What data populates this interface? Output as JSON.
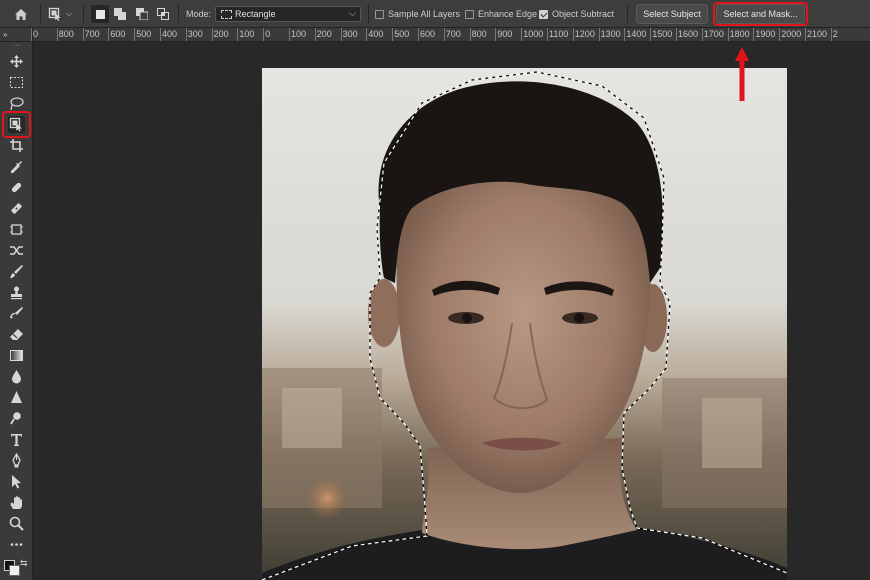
{
  "options_bar": {
    "mode_label": "Mode:",
    "mode_value": "Rectangle",
    "sample_all_layers": {
      "label": "Sample All Layers",
      "checked": false
    },
    "enhance_edge": {
      "label": "Enhance Edge",
      "checked": false
    },
    "object_subtract": {
      "label": "Object Subtract",
      "checked": true
    },
    "select_subject_label": "Select Subject",
    "select_and_mask_label": "Select and Mask..."
  },
  "ruler": {
    "corner": "»",
    "labels": [
      "0",
      "800",
      "700",
      "600",
      "500",
      "400",
      "300",
      "200",
      "100",
      "0",
      "100",
      "200",
      "300",
      "400",
      "500",
      "600",
      "700",
      "800",
      "900",
      "1000",
      "1100",
      "1200",
      "1300",
      "1400",
      "1500",
      "1600",
      "1700",
      "1800",
      "1900",
      "2000",
      "2100",
      "2"
    ]
  },
  "toolbar": {
    "tools": [
      "move-tool",
      "rectangular-marquee-tool",
      "lasso-tool",
      "object-selection-tool",
      "crop-tool",
      "eyedropper-tool",
      "spot-healing-brush-tool",
      "patch-tool",
      "frame-tool",
      "content-aware-move-tool",
      "brush-tool",
      "clone-stamp-tool",
      "history-brush-tool",
      "eraser-tool",
      "gradient-tool",
      "blur-tool",
      "sharpen-tool",
      "dodge-tool",
      "type-tool",
      "pen-tool",
      "path-selection-tool",
      "hand-tool",
      "zoom-tool",
      "edit-toolbar"
    ],
    "active_tool": "object-selection-tool",
    "highlight_color": "#e1141c"
  },
  "annotation": {
    "color": "#e1141c"
  }
}
